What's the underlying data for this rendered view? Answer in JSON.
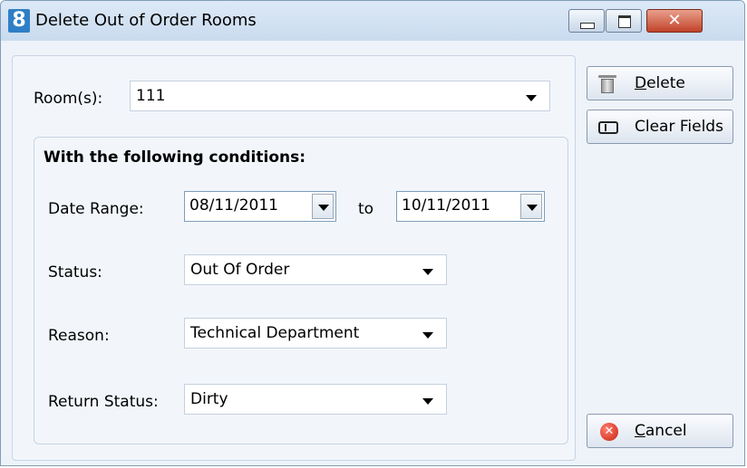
{
  "window": {
    "title": "Delete Out of Order Rooms",
    "app_icon_glyph": "8"
  },
  "form": {
    "rooms_label": "Room(s):",
    "rooms_value": "111",
    "group_title": "With the following conditions:",
    "date_range_label": "Date Range:",
    "date_from": "08/11/2011",
    "to_label": "to",
    "date_to": "10/11/2011",
    "status_label": "Status:",
    "status_value": "Out Of Order",
    "reason_label": "Reason:",
    "reason_value": "Technical Department",
    "return_status_label": "Return Status:",
    "return_status_value": "Dirty"
  },
  "buttons": {
    "delete_mnemonic": "D",
    "delete_rest": "elete",
    "clear_fields": "Clear Fields",
    "cancel_mnemonic": "C",
    "cancel_rest": "ancel"
  },
  "icons": {
    "app": "app-logo-icon",
    "delete": "trash-icon",
    "clear": "text-field-clear-icon",
    "cancel": "cancel-x-icon"
  }
}
